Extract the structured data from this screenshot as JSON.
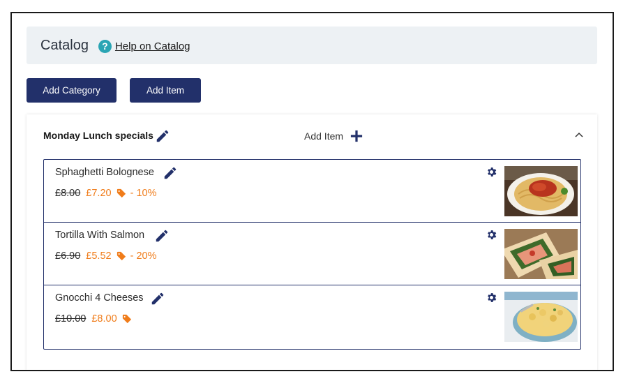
{
  "header": {
    "title": "Catalog",
    "help_link": "Help on Catalog"
  },
  "toolbar": {
    "add_category_label": "Add Category",
    "add_item_label": "Add Item"
  },
  "category": {
    "name": "Monday Lunch specials",
    "add_item_label": "Add Item",
    "items": [
      {
        "name": "Sphaghetti Bolognese",
        "old_price": "£8.00",
        "new_price": "£7.20",
        "discount": "- 10%"
      },
      {
        "name": "Tortilla With Salmon",
        "old_price": "£6.90",
        "new_price": "£5.52",
        "discount": "- 20%"
      },
      {
        "name": "Gnocchi 4 Cheeses",
        "old_price": "£10.00",
        "new_price": "£8.00",
        "discount": ""
      }
    ]
  },
  "icons": {
    "help": "question-circle-icon",
    "edit": "pencil-icon",
    "add": "plus-icon",
    "collapse": "chevron-up-icon",
    "settings": "gear-icon",
    "discount": "tag-icon"
  },
  "colors": {
    "primary": "#22306a",
    "accent": "#f07c1a",
    "help": "#2aa5b4",
    "header_bg": "#edf1f4"
  }
}
